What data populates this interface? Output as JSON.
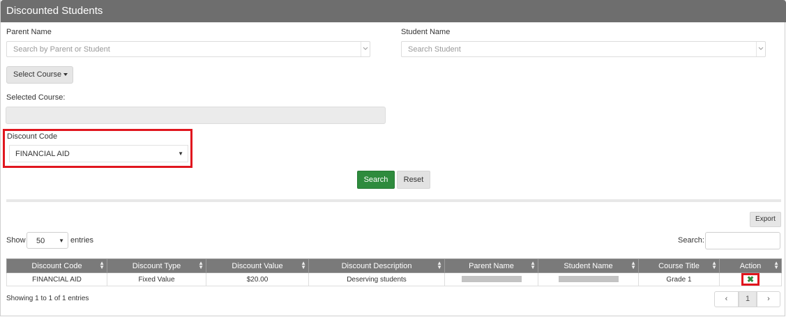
{
  "header": {
    "title": "Discounted Students"
  },
  "filters": {
    "parent_label": "Parent Name",
    "parent_placeholder": "Search by Parent or Student",
    "student_label": "Student Name",
    "student_placeholder": "Search Student",
    "course_button": "Select Course",
    "selected_course_label": "Selected Course:",
    "selected_course_value": "",
    "discount_label": "Discount Code",
    "discount_value": "FINANCIAL AID",
    "search_button": "Search",
    "reset_button": "Reset"
  },
  "table_controls": {
    "export": "Export",
    "show_label": "Show",
    "entries_label": "entries",
    "page_length": "50",
    "search_label": "Search:"
  },
  "table": {
    "columns": [
      "Discount Code",
      "Discount Type",
      "Discount Value",
      "Discount Description",
      "Parent Name",
      "Student Name",
      "Course Title",
      "Action"
    ],
    "rows": [
      {
        "discount_code": "FINANCIAL AID",
        "discount_type": "Fixed Value",
        "discount_value": "$20.00",
        "description": "Deserving students",
        "course_title": "Grade 1"
      }
    ]
  },
  "footer": {
    "info": "Showing 1 to 1 of 1 entries",
    "current_page": "1"
  },
  "colors": {
    "header": "#6e6e6e",
    "accent_green": "#2e8b3d",
    "highlight_red": "#e0161e"
  }
}
